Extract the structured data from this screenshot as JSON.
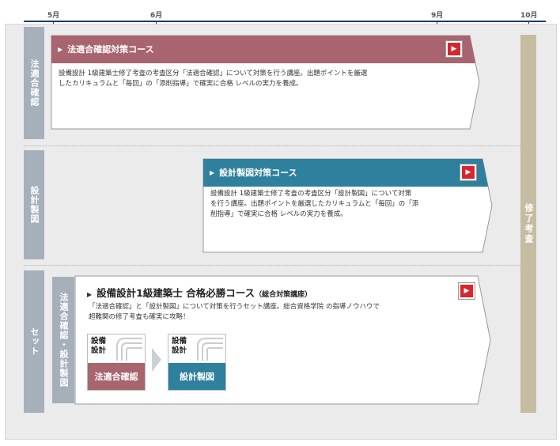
{
  "timeline": {
    "months": [
      "5月",
      "6月",
      "9月",
      "10月"
    ]
  },
  "rows": [
    {
      "label": "法適合確認"
    },
    {
      "label": "設計製図"
    },
    {
      "label": "セット"
    }
  ],
  "courses": [
    {
      "title": "法適合確認対策コース",
      "description": [
        "設備設計 1級建築士修了考査の考査区分「法適合確認」について対策を行う講座。出題ポイントを厳選",
        "したカリキュラムと「毎回」の「添削指導」で確実に合格 レベルの実力を養成。"
      ],
      "color": "#a8646f"
    },
    {
      "title": "設計製図対策コース",
      "description": [
        "設備設計 1級建築士修了考査の考査区分「設計製図」について対策",
        "を行う講座。出題ポイントを厳選したカリキュラムと「毎回」の「添",
        "削指導」で確実に合格 レベルの実力を養成。"
      ],
      "color": "#2e809d"
    }
  ],
  "set_course": {
    "side_label": "法適合確認・設計製図",
    "title": "設備設計1級建築士 合格必勝コース",
    "subtitle": "（総合対策講座）",
    "description": [
      "「法適合確認」と「設計製図」について対策を行うセット講座。総合資格学院 の指導ノウハウで",
      "超難関の修了考査も確実に攻略！"
    ],
    "cards": [
      {
        "top1": "設備",
        "top2": "設計",
        "label": "法適合確認",
        "color": "#a8646f"
      },
      {
        "top1": "設備",
        "top2": "設計",
        "label": "設計製図",
        "color": "#2e809d"
      }
    ]
  },
  "final_label": "修了考査",
  "icons": {
    "play": "play-icon",
    "triangle": "triangle-right-icon"
  }
}
